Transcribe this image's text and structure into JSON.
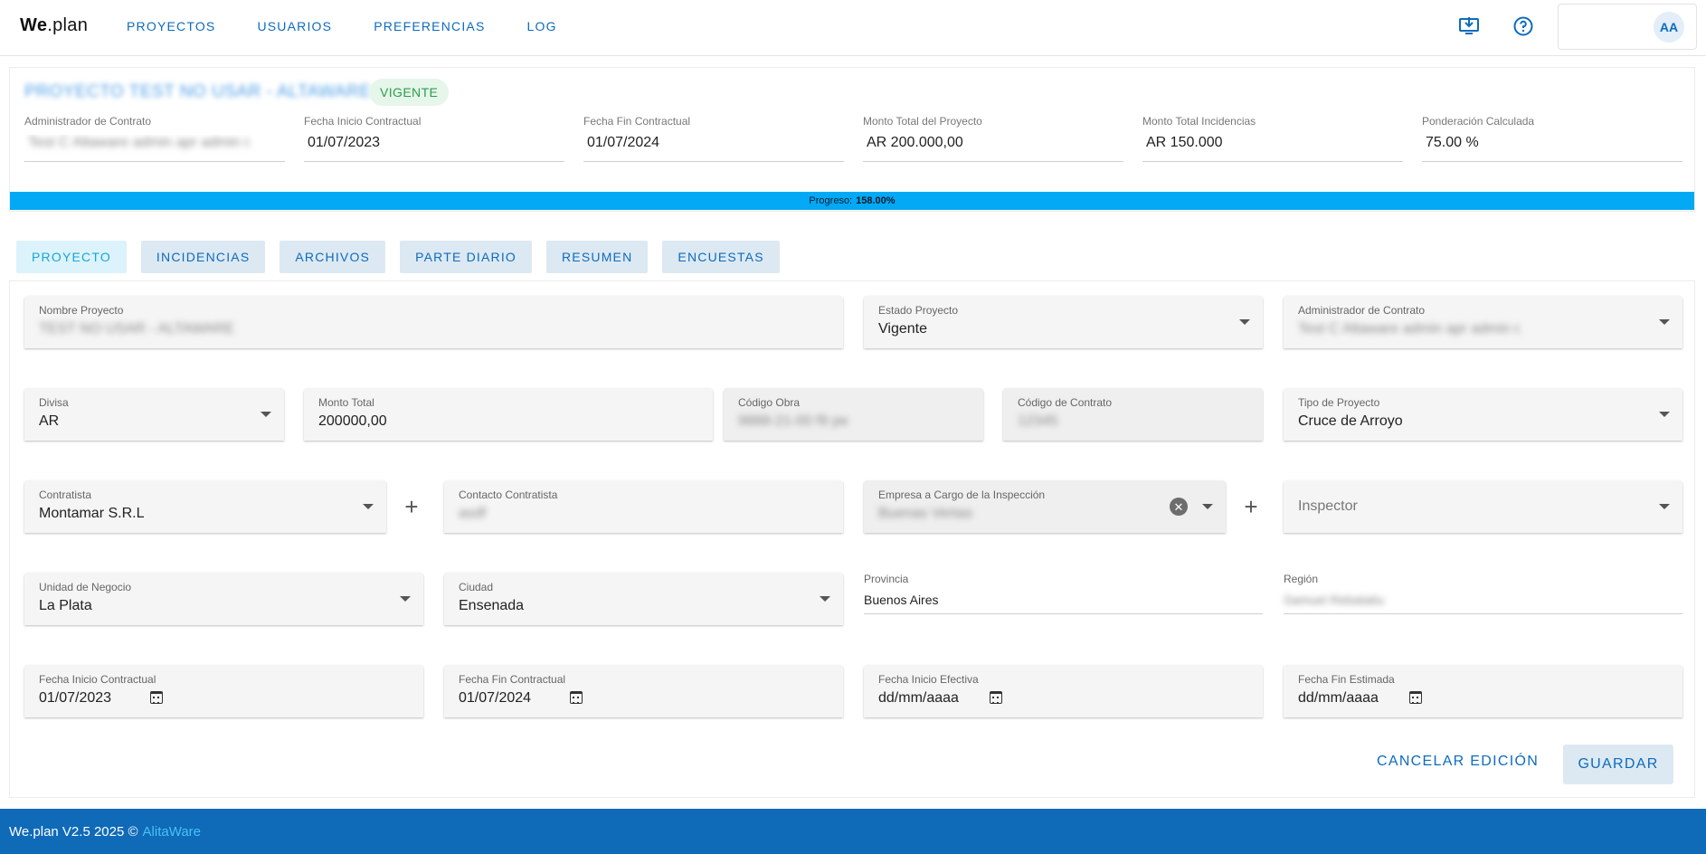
{
  "header": {
    "logo": {
      "bold": "We",
      "rest": ".plan"
    },
    "nav": [
      "PROYECTOS",
      "USUARIOS",
      "PREFERENCIAS",
      "LOG"
    ],
    "avatar": "AA"
  },
  "summary": {
    "title": "PROYECTO TEST NO USAR - ALTAWARE",
    "status": "VIGENTE",
    "fields": [
      {
        "label": "Administrador de Contrato",
        "value": "Test C Altaware admin apr admin r."
      },
      {
        "label": "Fecha Inicio Contractual",
        "value": "01/07/2023"
      },
      {
        "label": "Fecha Fin Contractual",
        "value": "01/07/2024"
      },
      {
        "label": "Monto Total del Proyecto",
        "value": "AR 200.000,00"
      },
      {
        "label": "Monto Total Incidencias",
        "value": "AR 150.000"
      },
      {
        "label": "Ponderación Calculada",
        "value": "75.00 %"
      }
    ],
    "progress": {
      "label": "Progreso:",
      "value": "158.00%",
      "fraction": 1.0
    }
  },
  "tabs": [
    "PROYECTO",
    "INCIDENCIAS",
    "ARCHIVOS",
    "PARTE DIARIO",
    "RESUMEN",
    "ENCUESTAS"
  ],
  "form": {
    "nombre_proyecto": {
      "label": "Nombre Proyecto",
      "value": "TEST NO USAR - ALTAWARE"
    },
    "estado_proyecto": {
      "label": "Estado Proyecto",
      "value": "Vigente"
    },
    "administrador": {
      "label": "Administrador de Contrato",
      "value": "Test C Altaware admin apr admin r."
    },
    "divisa": {
      "label": "Divisa",
      "value": "AR"
    },
    "monto_total": {
      "label": "Monto Total",
      "value": "200000,00"
    },
    "codigo_obra": {
      "label": "Código Obra",
      "value": "9888-21-00 f9 pe"
    },
    "codigo_contrato": {
      "label": "Código de Contrato",
      "value": "12345"
    },
    "tipo_proyecto": {
      "label": "Tipo de Proyecto",
      "value": "Cruce de Arroyo"
    },
    "contratista": {
      "label": "Contratista",
      "value": "Montamar S.R.L"
    },
    "contacto_contratista": {
      "label": "Contacto Contratista",
      "value": "asdf"
    },
    "empresa_inspeccion": {
      "label": "Empresa a Cargo de la Inspección",
      "value": "Buenas Vertas"
    },
    "inspector": {
      "placeholder": "Inspector"
    },
    "unidad_negocio": {
      "label": "Unidad de Negocio",
      "value": "La Plata"
    },
    "ciudad": {
      "label": "Ciudad",
      "value": "Ensenada"
    },
    "provincia": {
      "label": "Provincia",
      "value": "Buenos Aires"
    },
    "region": {
      "label": "Región",
      "value": "Samuel Rebatatiu"
    },
    "fecha_inicio_contractual": {
      "label": "Fecha Inicio Contractual",
      "value": "01/07/2023"
    },
    "fecha_fin_contractual": {
      "label": "Fecha Fin Contractual",
      "value": "01/07/2024"
    },
    "fecha_inicio_efectiva": {
      "label": "Fecha Inicio Efectiva",
      "value": "dd/mm/aaaa"
    },
    "fecha_fin_estimada": {
      "label": "Fecha Fin Estimada",
      "value": "dd/mm/aaaa"
    },
    "cancel_label": "CANCELAR EDICIÓN",
    "save_label": "GUARDAR"
  },
  "footer": {
    "text": "We.plan V2.5 2025 ©",
    "brand": "AlitaWare"
  },
  "colors": {
    "primary": "#0d6bbd",
    "progress": "#03a9f4",
    "footer": "#0f6ab8",
    "badge_bg": "#e6f6ea",
    "badge_fg": "#2a9d4b"
  }
}
